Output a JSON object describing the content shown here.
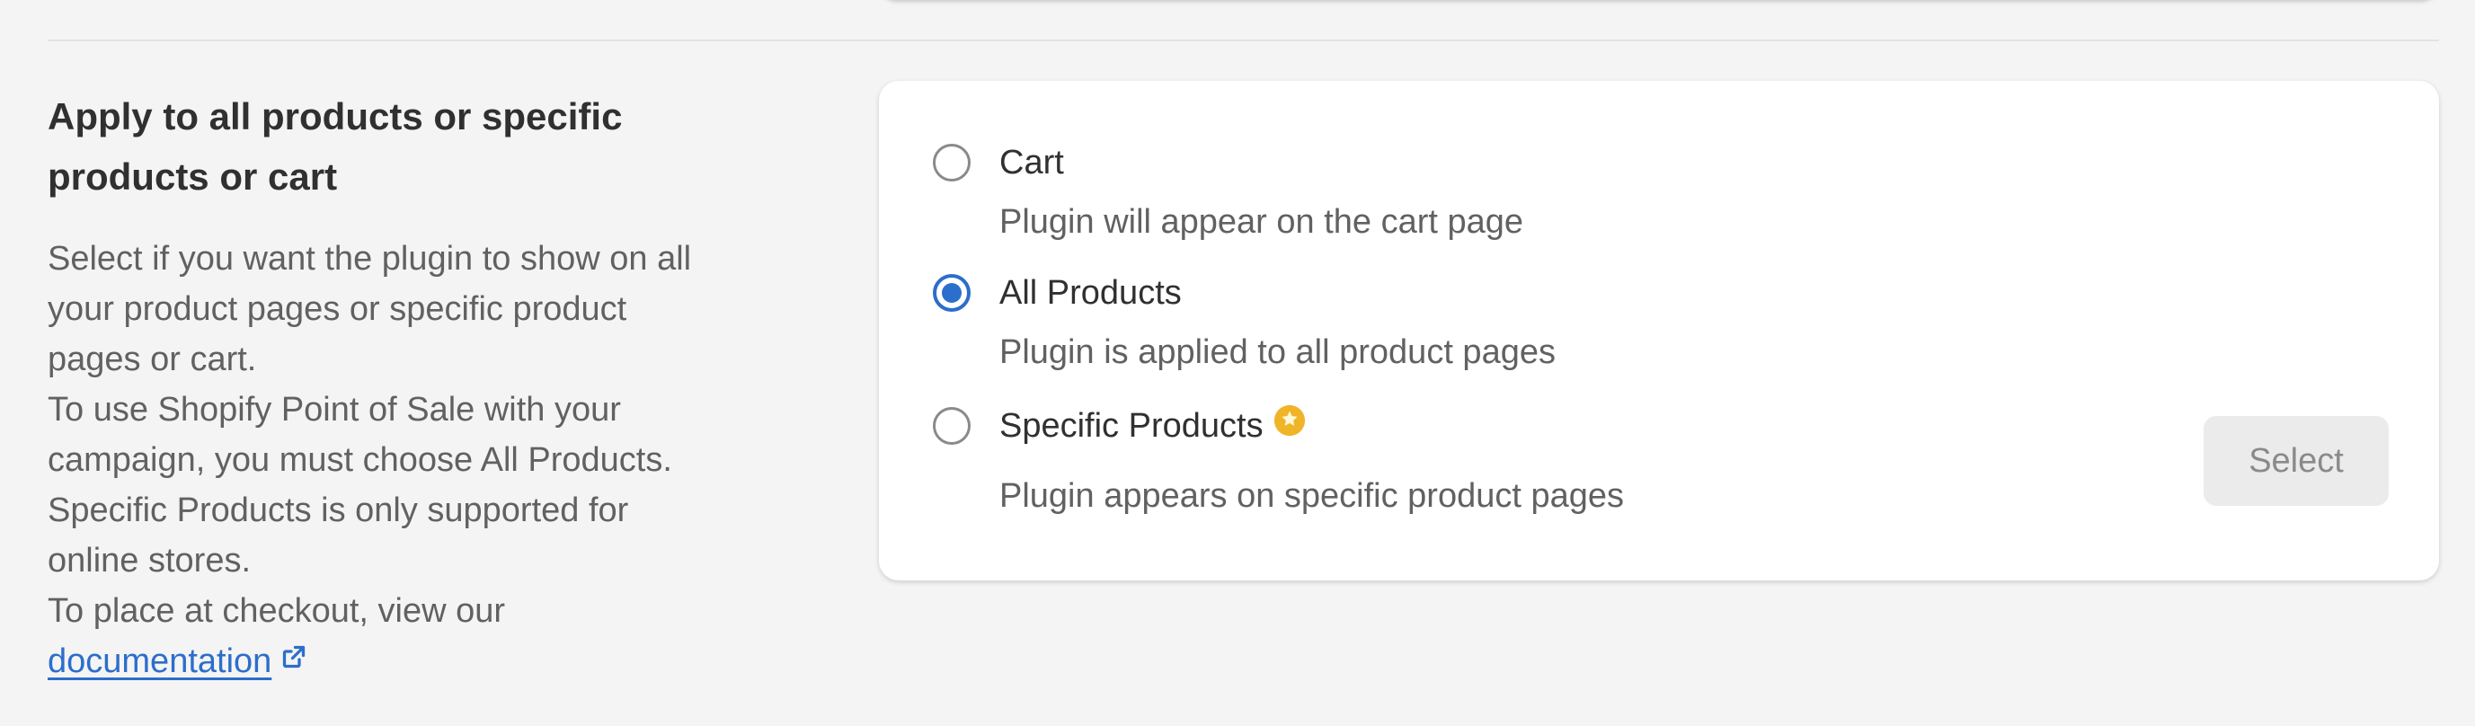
{
  "section": {
    "title_line1": "Apply to all products or specific",
    "title_line2": "products or cart",
    "description": [
      "Select if you want the plugin to show on all",
      "your product pages or specific product",
      "pages or cart.",
      "To use Shopify Point of Sale with your",
      "campaign, you must choose All Products.",
      "Specific Products is only supported for",
      "online stores.",
      "To place at checkout, view our"
    ],
    "link_text": "documentation",
    "link_icon": "external-link-icon"
  },
  "options": [
    {
      "label": "Cart",
      "help": "Plugin will appear on the cart page",
      "selected": false
    },
    {
      "label": "All Products",
      "help": "Plugin is applied to all product pages",
      "selected": true
    },
    {
      "label": "Specific Products",
      "help": "Plugin appears on specific product pages",
      "selected": false,
      "badge_icon": "premium-star-icon"
    }
  ],
  "select_button": {
    "label": "Select",
    "disabled": true
  },
  "colors": {
    "accent": "#2c6ecb",
    "badge": "#f0b429",
    "background": "#f4f4f4",
    "card": "#ffffff"
  }
}
